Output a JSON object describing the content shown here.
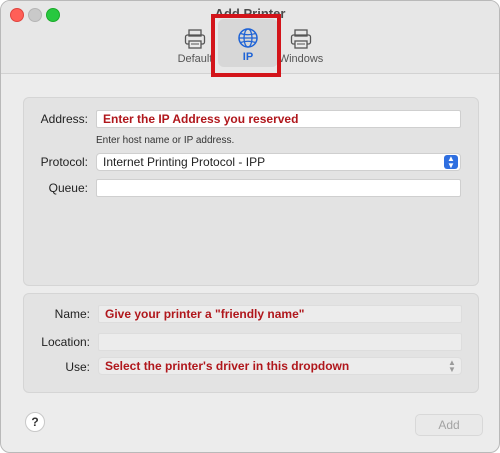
{
  "window": {
    "title": "Add Printer"
  },
  "toolbar": {
    "tabs": [
      {
        "label": "Default",
        "icon": "printer-icon"
      },
      {
        "label": "IP",
        "icon": "globe-icon",
        "selected": true
      },
      {
        "label": "Windows",
        "icon": "printer-icon"
      }
    ]
  },
  "form": {
    "address": {
      "label": "Address:",
      "value": "Enter the IP Address you reserved",
      "hint": "Enter host name or IP address."
    },
    "protocol": {
      "label": "Protocol:",
      "value": "Internet Printing Protocol - IPP"
    },
    "queue": {
      "label": "Queue:",
      "value": ""
    },
    "name": {
      "label": "Name:",
      "value": "Give your printer a \"friendly name\""
    },
    "location": {
      "label": "Location:",
      "value": ""
    },
    "use": {
      "label": "Use:",
      "value": "Select the printer's driver in this dropdown"
    }
  },
  "footer": {
    "help_label": "?",
    "add_label": "Add"
  },
  "colors": {
    "annotation": "#b0171c",
    "highlight": "#d3141a",
    "accent": "#2f6fe0"
  }
}
